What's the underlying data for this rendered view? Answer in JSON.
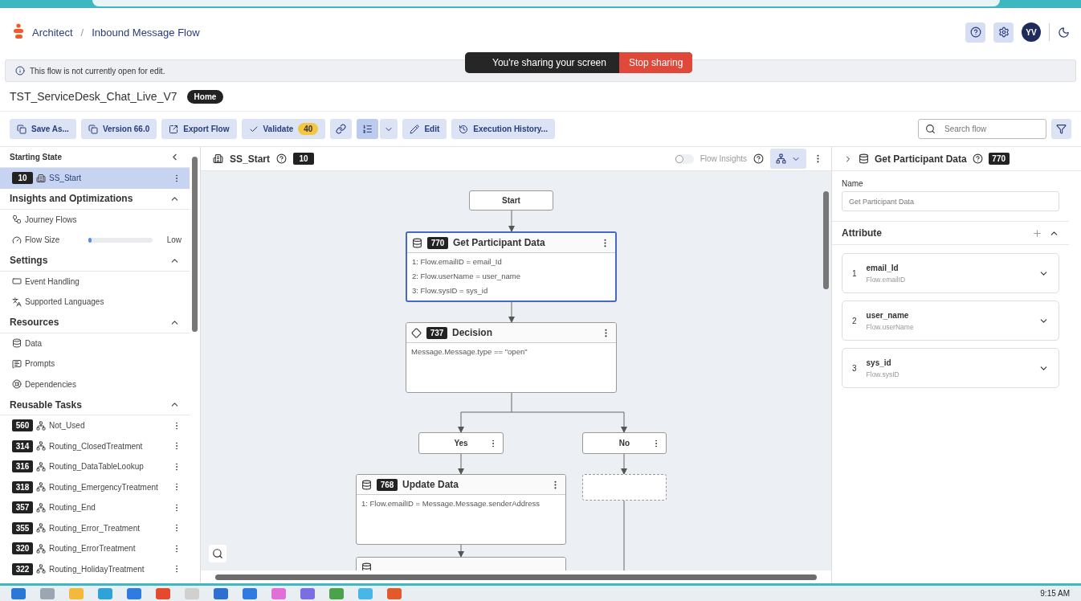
{
  "app": {
    "breadcrumb": [
      "Architect",
      "Inbound Message Flow"
    ],
    "separator": "/",
    "user_initials": "YV"
  },
  "share_bar": {
    "message": "You're sharing your screen",
    "button": "Stop sharing"
  },
  "banner": "This flow is not currently open for edit.",
  "flow": {
    "name": "TST_ServiceDesk_Chat_Live_V7",
    "tag": "Home"
  },
  "toolbar": [
    {
      "kind": "button",
      "label": "Save As..."
    },
    {
      "kind": "button",
      "label": "Version 66.0"
    },
    {
      "kind": "button",
      "label": "Export Flow"
    },
    {
      "kind": "validate",
      "label": "Validate",
      "count": "40"
    },
    {
      "kind": "icon"
    },
    {
      "kind": "split",
      "selected": true
    },
    {
      "kind": "button",
      "label": "Edit"
    },
    {
      "kind": "button",
      "label": "Execution History..."
    }
  ],
  "search": {
    "placeholder": "Search flow"
  },
  "sidebar": {
    "starting_state": {
      "title": "Starting State",
      "item": {
        "id": "10",
        "label": "SS_Start",
        "selected": true
      }
    },
    "sections": [
      {
        "title": "Insights and Optimizations",
        "expanded": true,
        "items": [
          {
            "kind": "link",
            "label": "Journey Flows"
          },
          {
            "kind": "meter",
            "label": "Flow Size",
            "level": 0.06,
            "reading": "Low"
          }
        ]
      },
      {
        "title": "Settings",
        "expanded": true,
        "items": [
          {
            "kind": "link",
            "label": "Event Handling"
          },
          {
            "kind": "link",
            "label": "Supported Languages"
          }
        ]
      },
      {
        "title": "Resources",
        "expanded": true,
        "items": [
          {
            "kind": "link",
            "label": "Data"
          },
          {
            "kind": "link",
            "label": "Prompts"
          },
          {
            "kind": "link",
            "label": "Dependencies"
          }
        ]
      },
      {
        "title": "Reusable Tasks",
        "expanded": true,
        "items": [
          {
            "kind": "task",
            "id": "560",
            "label": "Not_Used"
          },
          {
            "kind": "task",
            "id": "314",
            "label": "Routing_ClosedTreatment"
          },
          {
            "kind": "task",
            "id": "316",
            "label": "Routing_DataTableLookup"
          },
          {
            "kind": "task",
            "id": "318",
            "label": "Routing_EmergencyTreatment"
          },
          {
            "kind": "task",
            "id": "357",
            "label": "Routing_End"
          },
          {
            "kind": "task",
            "id": "355",
            "label": "Routing_Error_Treatment"
          },
          {
            "kind": "task",
            "id": "320",
            "label": "Routing_ErrorTreatment"
          },
          {
            "kind": "task",
            "id": "322",
            "label": "Routing_HolidayTreatment"
          }
        ]
      }
    ]
  },
  "canvas": {
    "title": "SS_Start",
    "id": "10",
    "insights": {
      "label": "Flow Insights",
      "on": false
    },
    "nodes": [
      {
        "kind": "terminal",
        "label": "Start"
      },
      {
        "kind": "data",
        "id": "770",
        "label": "Get Participant Data",
        "selected": true,
        "lines": [
          "1: Flow.emailID = email_Id",
          "2: Flow.userName = user_name",
          "3: Flow.sysID = sys_id"
        ]
      },
      {
        "kind": "decision",
        "id": "737",
        "label": "Decision",
        "selected": false,
        "lines": [
          "Message.Message.type == \"open\""
        ]
      },
      {
        "kind": "path",
        "label": "Yes"
      },
      {
        "kind": "path",
        "label": "No"
      },
      {
        "kind": "data",
        "id": "768",
        "label": "Update Data",
        "selected": false,
        "lines": [
          "1: Flow.emailID = Message.Message.senderAddress"
        ]
      },
      {
        "kind": "placeholder"
      },
      {
        "kind": "data"
      }
    ]
  },
  "panel": {
    "title": "Get Participant Data",
    "id": "770",
    "name_label": "Name",
    "name_value": "Get Participant Data",
    "attribute_title": "Attribute",
    "attributes": [
      {
        "index": "1",
        "name": "email_Id",
        "path": "Flow.emailID"
      },
      {
        "index": "2",
        "name": "user_name",
        "path": "Flow.userName"
      },
      {
        "index": "3",
        "name": "sys_id",
        "path": "Flow.sysID"
      }
    ]
  },
  "taskbar": {
    "time": "9:15 AM"
  }
}
